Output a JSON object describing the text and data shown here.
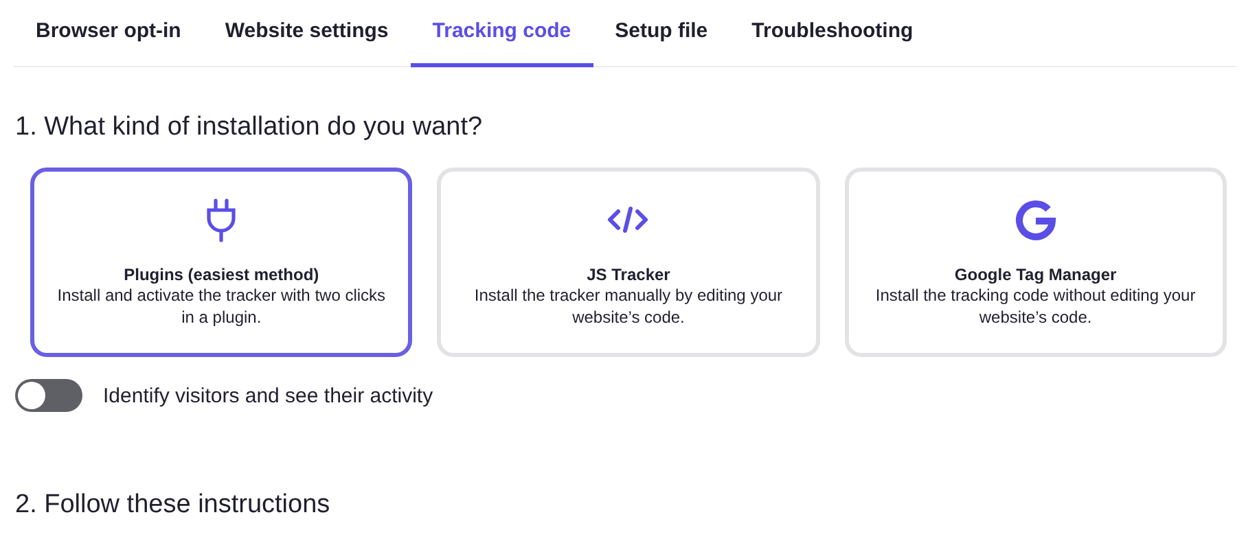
{
  "tabs": [
    {
      "label": "Browser opt-in",
      "selected": false
    },
    {
      "label": "Website settings",
      "selected": false
    },
    {
      "label": "Tracking code",
      "selected": true
    },
    {
      "label": "Setup file",
      "selected": false
    },
    {
      "label": "Troubleshooting",
      "selected": false
    }
  ],
  "step_1": {
    "heading": "1. What kind of installation do you want?",
    "options": [
      {
        "kind": "plug",
        "title": "Plugins (easiest method)",
        "description": "Install and activate the tracker with two clicks in a plugin.",
        "selected": true
      },
      {
        "kind": "code",
        "title": "JS Tracker",
        "description": "Install the tracker manually by editing your website’s code.",
        "selected": false
      },
      {
        "kind": "google",
        "title": "Google Tag Manager",
        "description": "Install the tracking code without editing your website’s code.",
        "selected": false
      }
    ],
    "toggle": {
      "label": "Identify visitors and see their activity",
      "on": false
    }
  },
  "step_2": {
    "heading": "2. Follow these instructions"
  }
}
